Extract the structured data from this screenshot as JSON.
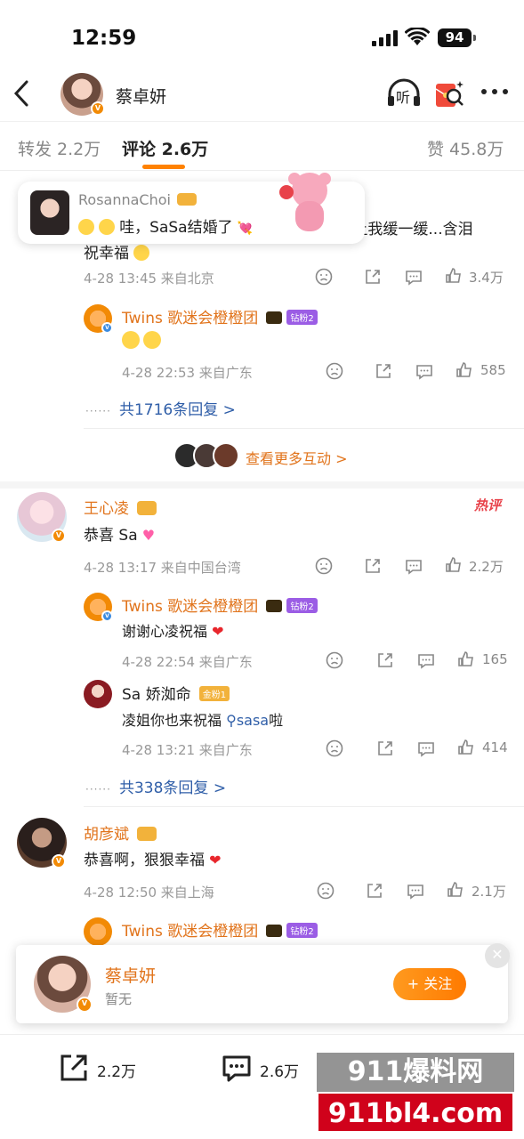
{
  "status_bar": {
    "time": "12:59",
    "battery": "94"
  },
  "header": {
    "title": "蔡卓妍",
    "listen_label": "听"
  },
  "tabs": {
    "repost": "转发 2.2万",
    "comments": "评论 2.6万",
    "likes": "赞 45.8万"
  },
  "toast": {
    "user": "RosannaChoi",
    "text": "哇，SaSa结婚了"
  },
  "comments": [
    {
      "text_visible": "没准备 让我缓一缓...含泪",
      "text_line2": "祝幸福",
      "meta": "4-28 13:45  来自北京",
      "likes": "3.4万",
      "reply": {
        "user": "Twins 歌迷会橙橙团",
        "badge": "钻粉2",
        "text": "",
        "meta": "4-28 22:53  来自广东",
        "likes": "585"
      },
      "more_replies": "共1716条回复 >"
    },
    {
      "user": "王心凌",
      "hot_tag": "热评",
      "text": "恭喜 Sa",
      "meta": "4-28 13:17  来自中国台湾",
      "likes": "2.2万",
      "replies": [
        {
          "user": "Twins 歌迷会橙橙团",
          "badge": "钻粉2",
          "text": "谢谢心凌祝福",
          "meta": "4-28 22:54  来自广东",
          "likes": "165"
        },
        {
          "user": "Sa 娇洳命",
          "badge": "金粉1",
          "text_pre": "凌姐你也来祝福",
          "text_link": "sasa",
          "text_post": "啦",
          "meta": "4-28 13:21  来自广东",
          "likes": "414"
        }
      ],
      "more_replies": "共338条回复 >"
    },
    {
      "user": "胡彦斌",
      "text": "恭喜啊，狠狠幸福",
      "meta": "4-28 12:50  来自上海",
      "likes": "2.1万",
      "reply": {
        "user": "Twins 歌迷会橙橙团",
        "badge": "钻粉2"
      }
    }
  ],
  "more_interactions": "查看更多互动 >",
  "follow_card": {
    "name": "蔡卓妍",
    "subtitle": "暂无",
    "button": "+ 关注"
  },
  "bottom_bar": {
    "repost": "2.2万",
    "comments": "2.6万"
  },
  "watermark": {
    "line1": "911爆料网",
    "line2": "911bl4.com"
  },
  "colors": {
    "accent": "#ff8200",
    "org_name": "#e1741c",
    "link": "#eb7350",
    "hot": "#e8424a"
  }
}
